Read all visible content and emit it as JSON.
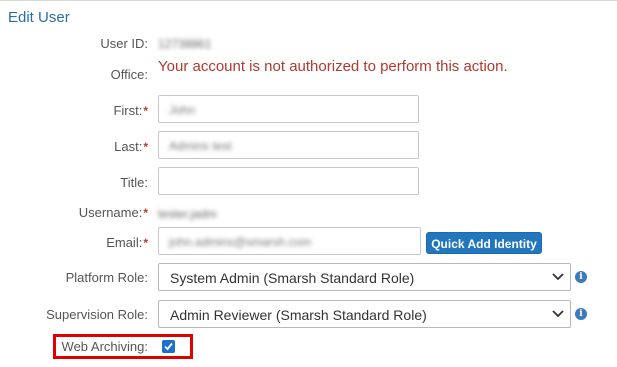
{
  "page": {
    "title": "Edit User"
  },
  "form": {
    "user_id": {
      "label": "User ID:",
      "value": "12738861"
    },
    "office": {
      "label": "Office:",
      "error": "Your account is not authorized to perform this action."
    },
    "first": {
      "label": "First:",
      "required": "*",
      "value": "John"
    },
    "last": {
      "label": "Last:",
      "required": "*",
      "value": "Admins test"
    },
    "title": {
      "label": "Title:",
      "value": ""
    },
    "username": {
      "label": "Username:",
      "required": "*",
      "value": "tester.jadm"
    },
    "email": {
      "label": "Email:",
      "required": "*",
      "value": "john.admins@smarsh.com",
      "button": "Quick Add Identity"
    },
    "platform_role": {
      "label": "Platform Role:",
      "value": "System Admin (Smarsh Standard Role)"
    },
    "supervision_role": {
      "label": "Supervision Role:",
      "value": "Admin Reviewer (Smarsh Standard Role)"
    },
    "web_archiving": {
      "label": "Web Archiving:",
      "checked": true
    }
  },
  "icons": {
    "info": "info-icon",
    "chevron": "chevron-down-icon",
    "check": "check-icon"
  },
  "colors": {
    "accent": "#2176bd",
    "error": "#b03a2e",
    "highlight": "#e00000",
    "required": "#c0392b"
  }
}
